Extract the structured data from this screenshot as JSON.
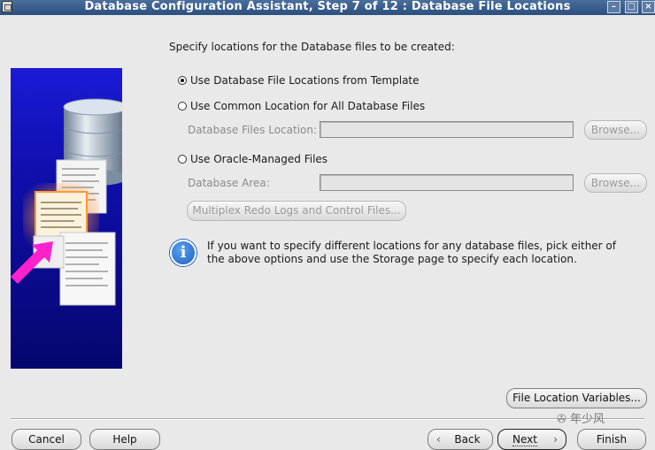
{
  "window": {
    "title": "Database Configuration Assistant, Step 7 of 12 : Database File Locations",
    "min_glyph": "–",
    "max_glyph": "□",
    "close_glyph": "×"
  },
  "heading": "Specify locations for the Database files to be created:",
  "options": {
    "template": {
      "label": "Use Database File Locations from Template",
      "selected": true
    },
    "common": {
      "label": "Use Common Location for All Database Files",
      "selected": false,
      "field_label": "Database Files Location:",
      "field_value": "",
      "browse_label": "Browse..."
    },
    "oracle_managed": {
      "label": "Use Oracle-Managed Files",
      "selected": false,
      "field_label": "Database Area:",
      "field_value": "",
      "browse_label": "Browse...",
      "multiplex_label": "Multiplex Redo Logs and Control Files..."
    }
  },
  "info": {
    "icon": "info-icon",
    "text": "If you want to specify different locations for any database files, pick either of the above options and use the Storage page to specify each location."
  },
  "file_location_variables_label": "File Location Variables...",
  "footer": {
    "cancel": "Cancel",
    "help": "Help",
    "back": "Back",
    "next": "Next",
    "finish": "Finish"
  },
  "watermark": "年少风",
  "colors": {
    "titlebar": "#2c4f7d",
    "panel": "#1010c0",
    "arrow": "#ff22cc"
  }
}
